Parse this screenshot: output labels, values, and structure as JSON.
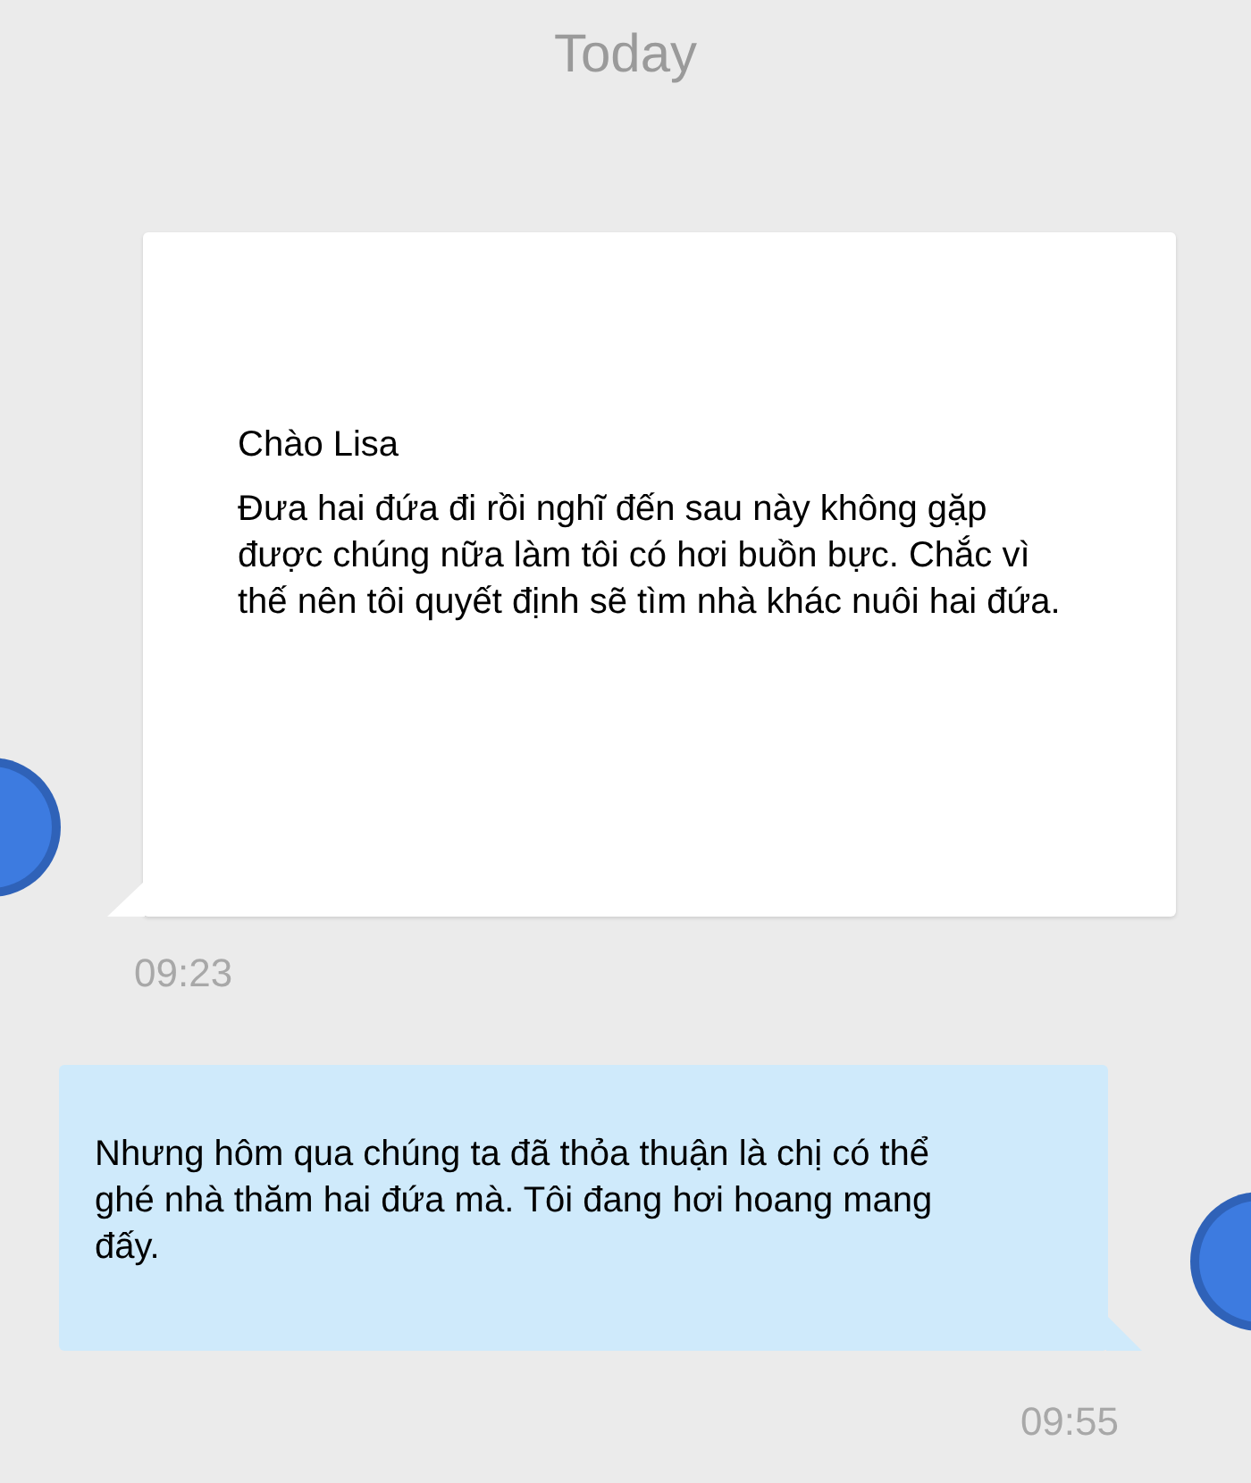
{
  "date_divider": "Today",
  "messages": [
    {
      "kind": "incoming",
      "paragraphs": [
        "Chào Lisa",
        "Đưa hai đứa đi rồi nghĩ đến sau này không gặp được chúng nữa làm tôi có hơi buồn bực. Chắc vì thế nên tôi quyết định sẽ tìm nhà khác nuôi hai đứa."
      ],
      "time": "09:23"
    },
    {
      "kind": "outgoing",
      "paragraphs": [
        "Nhưng hôm qua chúng ta đã thỏa thuận là chị có thể ghé nhà thăm hai đứa mà. Tôi đang hơi hoang mang đấy."
      ],
      "time": "09:55"
    }
  ]
}
